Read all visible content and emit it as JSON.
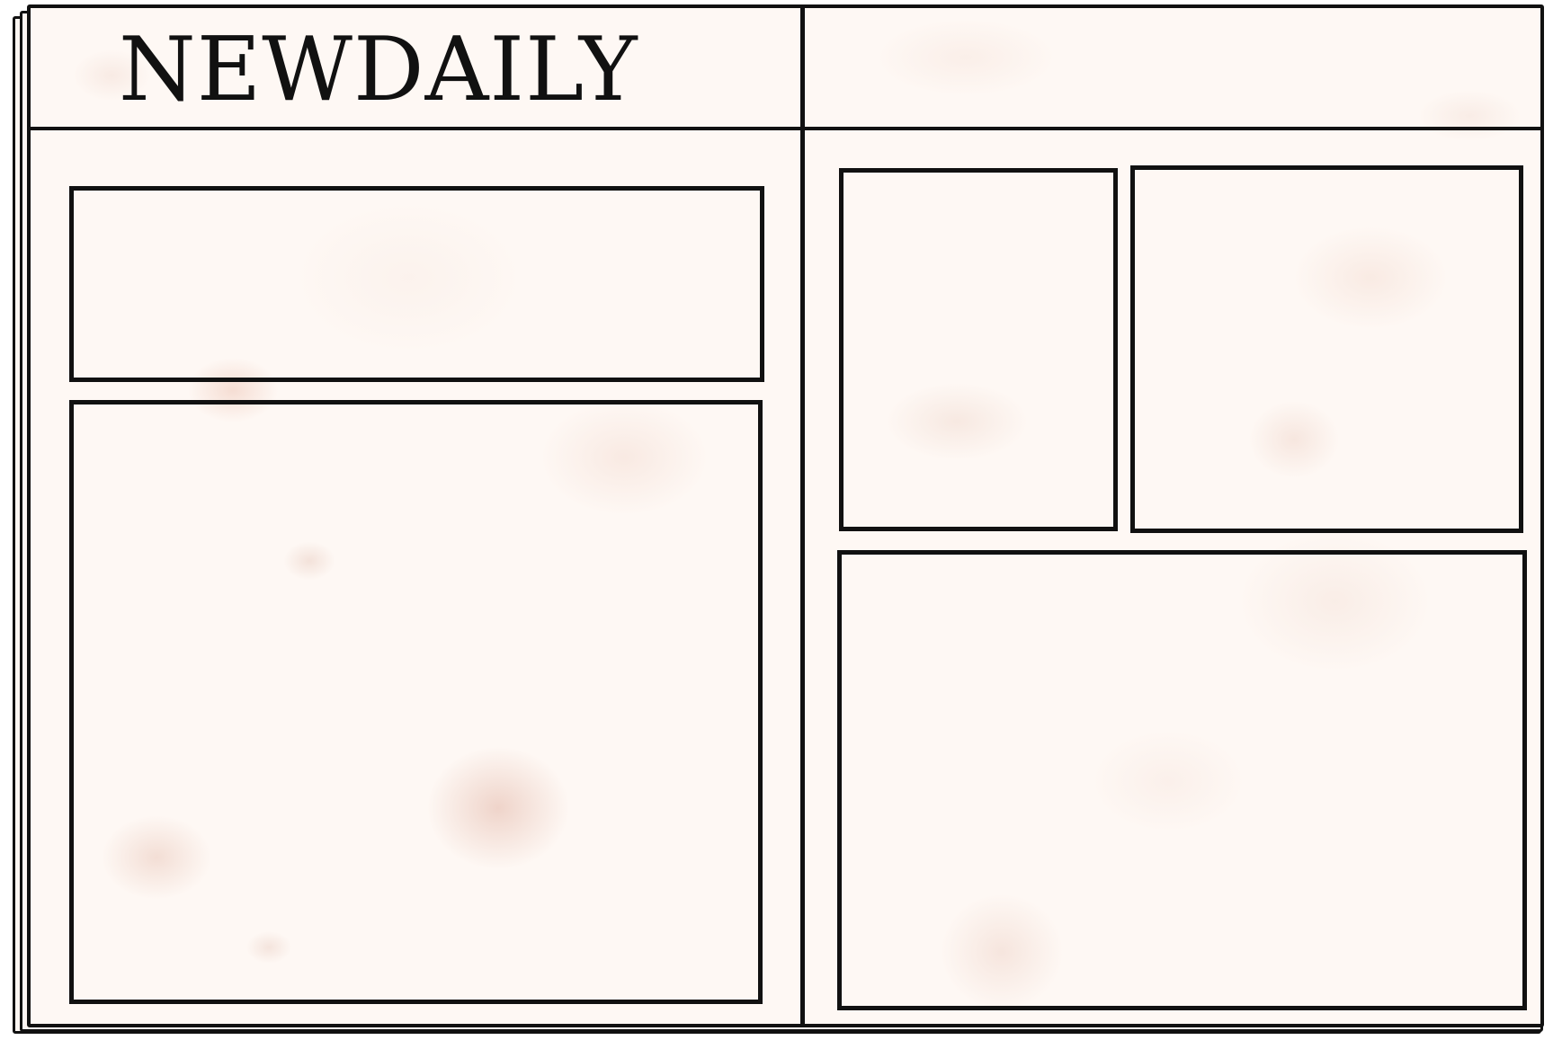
{
  "newspaper": {
    "masthead": "NEWDAILY",
    "left_page": {
      "panels": [
        "headline-box",
        "main-article-box"
      ]
    },
    "right_page": {
      "panels": [
        "small-left-box",
        "small-right-box",
        "bottom-article-box"
      ]
    }
  },
  "colors": {
    "ink": "#111111",
    "paper": "#fef8f4",
    "stain": "#e0b0a0"
  }
}
